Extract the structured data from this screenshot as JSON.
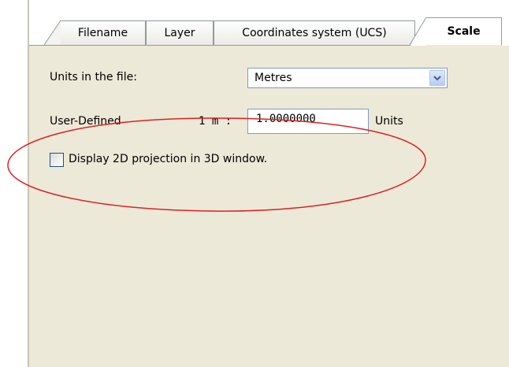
{
  "tabs": [
    {
      "label": "Filename",
      "active": false
    },
    {
      "label": "Layer",
      "active": false
    },
    {
      "label": "Coordinates system (UCS)",
      "active": false
    },
    {
      "label": "Scale",
      "active": true
    }
  ],
  "units": {
    "label": "Units in the file:",
    "selected": "Metres"
  },
  "user_defined": {
    "label": "User-Defined",
    "ratio_prefix": "1 m :",
    "value": "1.0000000",
    "suffix": "Units"
  },
  "projection": {
    "label": "Display 2D projection in 3D window.",
    "checked": false
  },
  "annotation": {
    "color": "#e02020"
  }
}
